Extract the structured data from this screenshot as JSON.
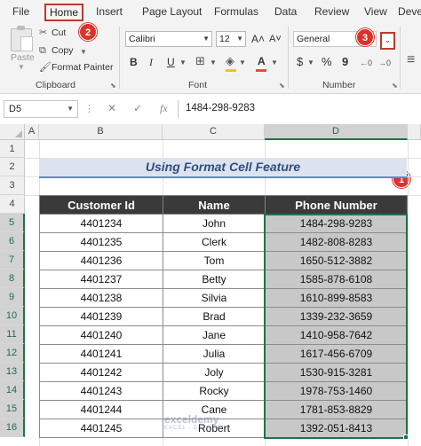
{
  "menu": {
    "tabs": [
      "File",
      "Home",
      "Insert",
      "Page Layout",
      "Formulas",
      "Data",
      "Review",
      "View",
      "Deve"
    ],
    "active": "Home"
  },
  "ribbon": {
    "clipboard": {
      "paste": "Paste",
      "cut": "Cut",
      "copy": "Copy",
      "format_painter": "Format Painter",
      "group_label": "Clipboard"
    },
    "font": {
      "name": "Calibri",
      "size": "12",
      "bold": "B",
      "italic": "I",
      "underline": "U",
      "grow": "A˄",
      "shrink": "A˅",
      "font_color": "A",
      "group_label": "Font"
    },
    "number": {
      "format": "General",
      "currency": "$",
      "percent": "%",
      "comma": "9",
      "group_label": "Number"
    },
    "alignment_fragment": "≡"
  },
  "badges": {
    "one": "1",
    "two": "2",
    "three": "3"
  },
  "formula_bar": {
    "name_box": "D5",
    "fx": "fx",
    "content": "1484-298-9283"
  },
  "columns": [
    "A",
    "B",
    "C",
    "D"
  ],
  "rows": [
    "1",
    "2",
    "3",
    "4",
    "5",
    "6",
    "7",
    "8",
    "9",
    "10",
    "11",
    "12",
    "13",
    "14",
    "15",
    "16"
  ],
  "sheet": {
    "title": "Using Format Cell Feature",
    "headers": [
      "Customer Id",
      "Name",
      "Phone Number"
    ],
    "records": [
      {
        "id": "4401234",
        "name": "John",
        "phone": "1484-298-9283"
      },
      {
        "id": "4401235",
        "name": "Clerk",
        "phone": "1482-808-8283"
      },
      {
        "id": "4401236",
        "name": "Tom",
        "phone": "1650-512-3882"
      },
      {
        "id": "4401237",
        "name": "Betty",
        "phone": "1585-878-6108"
      },
      {
        "id": "4401238",
        "name": "Silvia",
        "phone": "1610-899-8583"
      },
      {
        "id": "4401239",
        "name": "Brad",
        "phone": "1339-232-3659"
      },
      {
        "id": "4401240",
        "name": "Jane",
        "phone": "1410-958-7642"
      },
      {
        "id": "4401241",
        "name": "Julia",
        "phone": "1617-456-6709"
      },
      {
        "id": "4401242",
        "name": "Joly",
        "phone": "1530-915-3281"
      },
      {
        "id": "4401243",
        "name": "Rocky",
        "phone": "1978-753-1460"
      },
      {
        "id": "4401244",
        "name": "Cane",
        "phone": "1781-853-8829"
      },
      {
        "id": "4401245",
        "name": "Robert",
        "phone": "1392-051-8413"
      }
    ]
  },
  "watermark": {
    "main": "exceldemy",
    "sub": "EXCEL · DATA · BI"
  },
  "colors": {
    "accent_green": "#217346",
    "badge_red": "#d9342b",
    "header_dark": "#3a3a3a",
    "phone_fill": "#c8c8c8",
    "title_fill": "#dde3ee"
  }
}
